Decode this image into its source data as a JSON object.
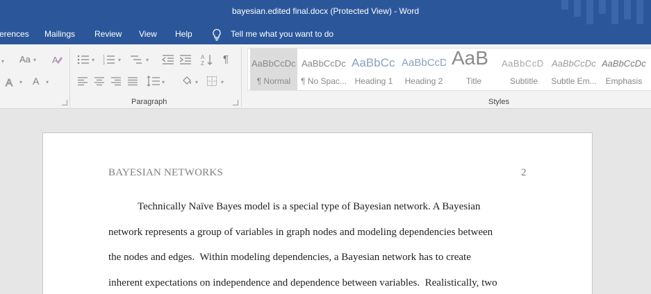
{
  "window": {
    "title": "bayesian.edited final.docx (Protected View)  -  Word"
  },
  "ribbon_tabs": [
    "erences",
    "Mailings",
    "Review",
    "View",
    "Help"
  ],
  "tell_me": {
    "text": "Tell me what you want to do",
    "icon": "lightbulb-icon"
  },
  "groups": {
    "paragraph_label": "Paragraph",
    "styles_label": "Styles"
  },
  "font_controls": {
    "change_case": "Aa",
    "clear_format": "A",
    "text_effects": "A",
    "font_color": "A"
  },
  "styles": [
    {
      "sample": "AaBbCcDc",
      "name": "¶ Normal"
    },
    {
      "sample": "AaBbCcDc",
      "name": "¶ No Spac..."
    },
    {
      "sample": "AaBbCc",
      "name": "Heading 1"
    },
    {
      "sample": "AaBbCcD",
      "name": "Heading 2"
    },
    {
      "sample": "AaB",
      "name": "Title"
    },
    {
      "sample": "AaBbCcD",
      "name": "Subtitle"
    },
    {
      "sample": "AaBbCcDc",
      "name": "Subtle Em..."
    },
    {
      "sample": "AaBbCcDc",
      "name": "Emphasis"
    }
  ],
  "document": {
    "header": "BAYESIAN NETWORKS",
    "page_number": "2",
    "lines": [
      "Technically Naïve Bayes model is a special type of Bayesian network. A Bayesian",
      "network represents a group of variables in graph nodes and modeling dependencies between",
      "the nodes and edges.  Within modeling dependencies, a Bayesian network has to create",
      "inherent expectations on independence and dependence between variables.  Realistically, two"
    ]
  },
  "colors": {
    "accent": "#2b579a",
    "ribbon_bg": "#f3f3f3",
    "canvas": "#e6e6e6"
  }
}
